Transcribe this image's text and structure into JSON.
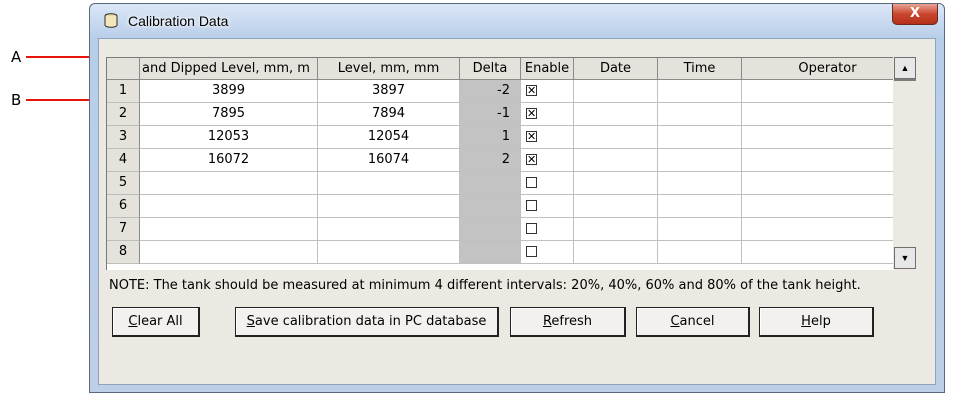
{
  "annotations": {
    "a": "A",
    "b": "B"
  },
  "window": {
    "title": "Calibration Data",
    "close_symbol": "X"
  },
  "grid": {
    "columns": [
      "and Dipped Level, mm, m",
      "Level, mm, mm",
      "Delta",
      "Enable",
      "Date",
      "Time",
      "Operator"
    ],
    "rows": [
      {
        "num": "1",
        "dipped": "3899",
        "level": "3897",
        "delta": "-2",
        "enabled": true,
        "date": "",
        "time": "",
        "operator": ""
      },
      {
        "num": "2",
        "dipped": "7895",
        "level": "7894",
        "delta": "-1",
        "enabled": true,
        "date": "",
        "time": "",
        "operator": ""
      },
      {
        "num": "3",
        "dipped": "12053",
        "level": "12054",
        "delta": "1",
        "enabled": true,
        "date": "",
        "time": "",
        "operator": ""
      },
      {
        "num": "4",
        "dipped": "16072",
        "level": "16074",
        "delta": "2",
        "enabled": true,
        "date": "",
        "time": "",
        "operator": ""
      },
      {
        "num": "5",
        "dipped": "",
        "level": "",
        "delta": "",
        "enabled": false,
        "date": "",
        "time": "",
        "operator": ""
      },
      {
        "num": "6",
        "dipped": "",
        "level": "",
        "delta": "",
        "enabled": false,
        "date": "",
        "time": "",
        "operator": ""
      },
      {
        "num": "7",
        "dipped": "",
        "level": "",
        "delta": "",
        "enabled": false,
        "date": "",
        "time": "",
        "operator": ""
      },
      {
        "num": "8",
        "dipped": "",
        "level": "",
        "delta": "",
        "enabled": false,
        "date": "",
        "time": "",
        "operator": ""
      }
    ],
    "checkmark": "✕"
  },
  "scrollbar": {
    "up": "▲",
    "down": "▼"
  },
  "note": "NOTE: The tank should be measured at minimum 4 different intervals:  20%, 40%, 60% and 80% of the tank height.",
  "buttons": {
    "clear_all": {
      "pre": "",
      "accel": "C",
      "post": "lear All"
    },
    "save": {
      "pre": "",
      "accel": "S",
      "post": "ave calibration data in PC database"
    },
    "refresh": {
      "pre": "",
      "accel": "R",
      "post": "efresh"
    },
    "cancel": {
      "pre": "",
      "accel": "C",
      "post": "ancel"
    },
    "help": {
      "pre": "",
      "accel": "H",
      "post": "elp"
    }
  },
  "colors": {
    "arrow": "#e8140c",
    "delta_fill": "#c3c3c3",
    "close": "#c9462d"
  }
}
